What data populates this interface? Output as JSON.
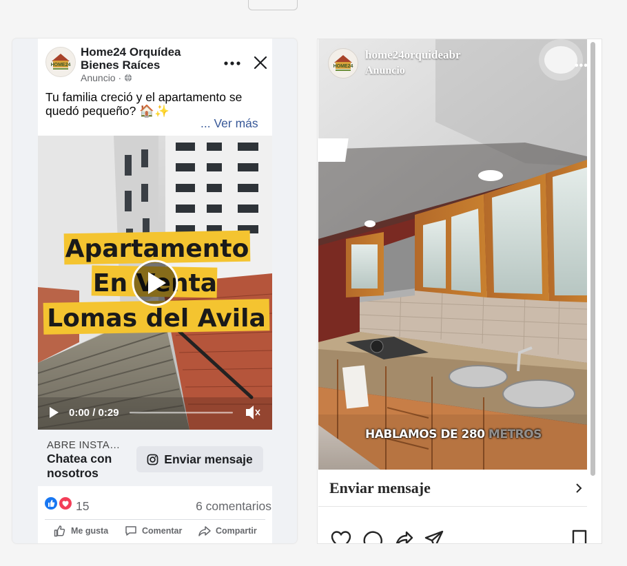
{
  "facebook_ad": {
    "page_name": "Home24 Orquídea Bienes Raíces",
    "sponsored_label": "Anuncio ·",
    "post_text": "Tu familia creció y el apartamento se quedó pequeño? 🏠✨",
    "see_more": "... Ver más",
    "video": {
      "overlay_lines": [
        "Apartamento",
        "En Venta",
        "Lomas del Avila"
      ],
      "time": "0:00 / 0:29",
      "progress": 0
    },
    "cta": {
      "small_label": "ABRE INSTA…",
      "big_label": "Chatea con nosotros",
      "button_label": "Enviar mensaje"
    },
    "reactions_count": "15",
    "comments": "6 comentarios",
    "actions": [
      "Me gusta",
      "Comentar",
      "Compartir"
    ],
    "avatar_logo_text": "HOME24"
  },
  "instagram_ad": {
    "username": "home24orquideabr",
    "sponsored_label": "Anuncio",
    "caption_main": "HABLAMOS DE 280 ",
    "caption_dim": "METROS",
    "cta_label": "Enviar mensaje",
    "cta_chevron": "›",
    "avatar_logo_text": "HOME24"
  },
  "colors": {
    "facebook_blue": "#1877f2",
    "love_red": "#f33e58",
    "overlay_yellow": "#f4c430",
    "link_blue": "#385898"
  }
}
